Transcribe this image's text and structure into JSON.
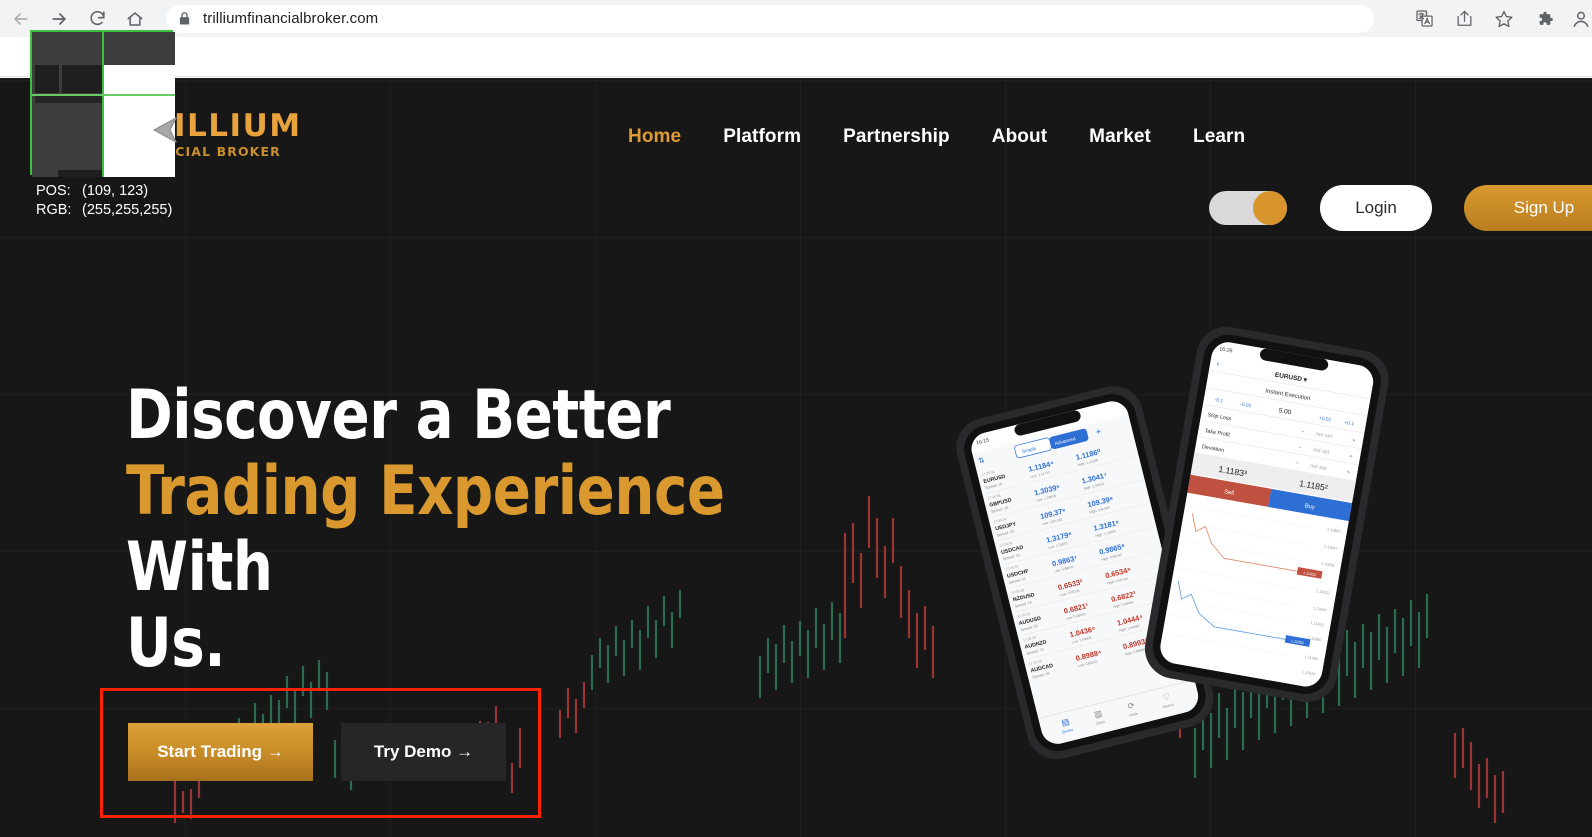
{
  "browser": {
    "back_icon": "arrow-left-icon",
    "forward_icon": "arrow-right-icon",
    "reload_icon": "reload-icon",
    "home_icon": "home-icon",
    "lock_icon": "lock-icon",
    "url": "trilliumfinancialbroker.com",
    "actions": [
      {
        "name": "translate-icon"
      },
      {
        "name": "share-icon"
      },
      {
        "name": "bookmark-star-icon"
      },
      {
        "name": "extensions-puzzle-icon"
      },
      {
        "name": "profile-avatar"
      }
    ]
  },
  "site": {
    "logo": {
      "name": "TRILLIUM",
      "tagline": "FINANCIAL BROKER"
    },
    "nav": [
      {
        "label": "Home",
        "active": true
      },
      {
        "label": "Platform",
        "active": false
      },
      {
        "label": "Partnership",
        "active": false
      },
      {
        "label": "About",
        "active": false
      },
      {
        "label": "Market",
        "active": false
      },
      {
        "label": "Learn",
        "active": false
      }
    ],
    "toggle": {
      "name": "theme-toggle",
      "state": "on"
    },
    "login_label": "Login",
    "signup_label": "Sign Up"
  },
  "hero": {
    "line1": "Discover a Better ",
    "line2_accent": "Trading Experience",
    "line2_rest": " With",
    "line3": "Us.",
    "primary_cta": "Start Trading →",
    "secondary_cta": "Try Demo →"
  },
  "magnifier": {
    "pos_label": "POS:",
    "pos_value": "(109, 123)",
    "rgb_label": "RGB:",
    "rgb_value": "(255,255,255)"
  },
  "colors": {
    "brand_gold": "#d9992f",
    "page_bg": "#171717",
    "annotation_red": "#ff2200",
    "magnifier_green": "#3fbf3f"
  }
}
